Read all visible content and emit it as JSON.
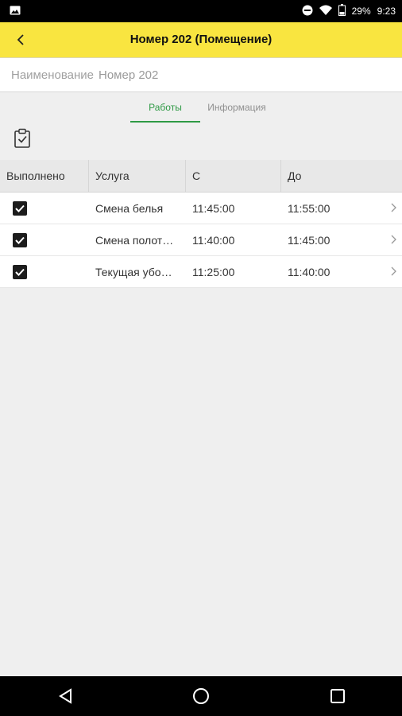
{
  "status_bar": {
    "battery": "29%",
    "time": "9:23",
    "icons": [
      "image-icon",
      "do-not-disturb-icon",
      "wifi-icon",
      "battery-icon"
    ]
  },
  "app_bar": {
    "title": "Номер 202 (Помещение)",
    "back_icon": "chevron-left-icon",
    "color": "#f9e540"
  },
  "name_field": {
    "label": "Наименование",
    "value": "Номер 202"
  },
  "tabs": [
    {
      "label": "Работы",
      "active": true
    },
    {
      "label": "Информация",
      "active": false
    }
  ],
  "accent_color": "#2f9a45",
  "toolbar": {
    "icon": "clipboard-check-icon"
  },
  "table": {
    "columns": [
      "Выполнено",
      "Услуга",
      "С",
      "До"
    ],
    "rows": [
      {
        "done": true,
        "service": "Смена белья",
        "from": "11:45:00",
        "to": "11:55:00"
      },
      {
        "done": true,
        "service": "Смена полот…",
        "from": "11:40:00",
        "to": "11:45:00"
      },
      {
        "done": true,
        "service": "Текущая убо…",
        "from": "11:25:00",
        "to": "11:40:00"
      }
    ]
  },
  "nav_bar": {
    "icons": [
      "back-triangle-icon",
      "home-circle-icon",
      "recents-square-icon"
    ]
  }
}
